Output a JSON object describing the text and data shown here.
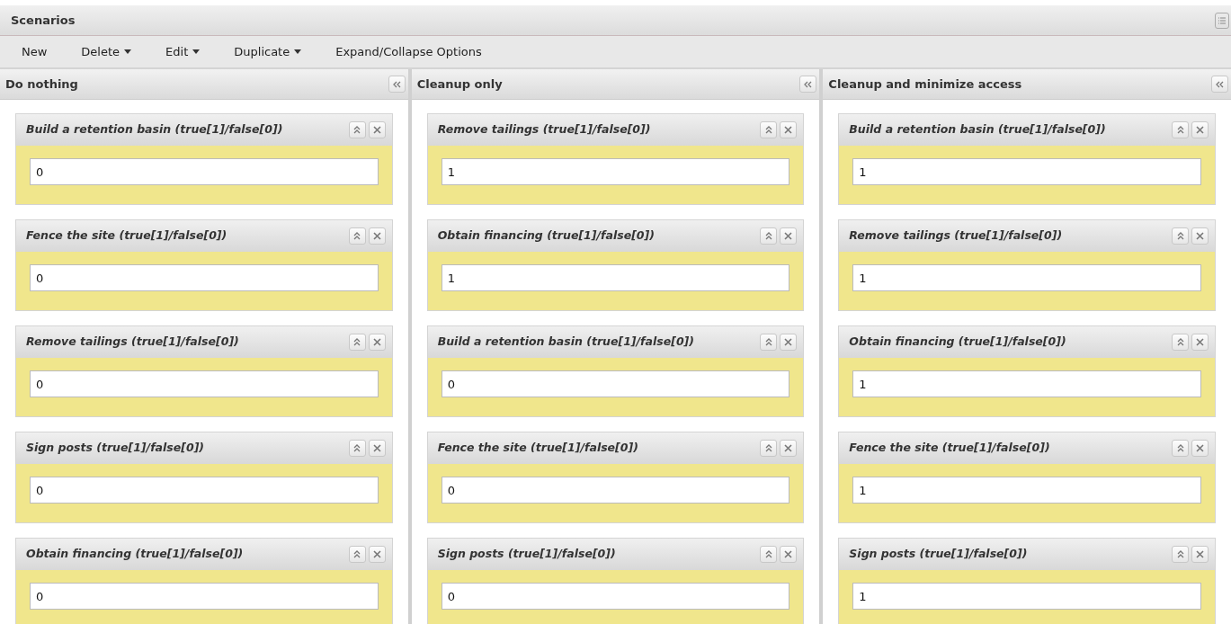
{
  "window": {
    "title": "Scenarios"
  },
  "toolbar": [
    {
      "label": "New",
      "dropdown": false
    },
    {
      "label": "Delete",
      "dropdown": true
    },
    {
      "label": "Edit",
      "dropdown": true
    },
    {
      "label": "Duplicate",
      "dropdown": true
    },
    {
      "label": "Expand/Collapse Options",
      "dropdown": false
    }
  ],
  "columns": [
    {
      "title": "Do nothing",
      "cards": [
        {
          "title": "Build a retention basin (true[1]/false[0])",
          "value": "0"
        },
        {
          "title": "Fence the site (true[1]/false[0])",
          "value": "0"
        },
        {
          "title": "Remove tailings (true[1]/false[0])",
          "value": "0"
        },
        {
          "title": "Sign posts (true[1]/false[0])",
          "value": "0"
        },
        {
          "title": "Obtain financing (true[1]/false[0])",
          "value": "0"
        }
      ]
    },
    {
      "title": "Cleanup only",
      "cards": [
        {
          "title": "Remove tailings (true[1]/false[0])",
          "value": "1"
        },
        {
          "title": "Obtain financing (true[1]/false[0])",
          "value": "1"
        },
        {
          "title": "Build a retention basin (true[1]/false[0])",
          "value": "0"
        },
        {
          "title": "Fence the site (true[1]/false[0])",
          "value": "0"
        },
        {
          "title": "Sign posts (true[1]/false[0])",
          "value": "0"
        }
      ]
    },
    {
      "title": "Cleanup and minimize access",
      "cards": [
        {
          "title": "Build a retention basin (true[1]/false[0])",
          "value": "1"
        },
        {
          "title": "Remove tailings (true[1]/false[0])",
          "value": "1"
        },
        {
          "title": "Obtain financing (true[1]/false[0])",
          "value": "1"
        },
        {
          "title": "Fence the site (true[1]/false[0])",
          "value": "1"
        },
        {
          "title": "Sign posts (true[1]/false[0])",
          "value": "1"
        }
      ]
    }
  ]
}
